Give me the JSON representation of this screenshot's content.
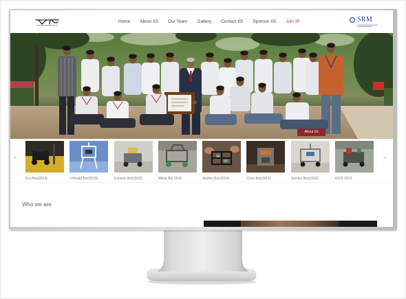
{
  "nav": {
    "items": [
      {
        "label": "Home"
      },
      {
        "label": "About IIS"
      },
      {
        "label": "Our Team"
      },
      {
        "label": "Gallery"
      },
      {
        "label": "Contact IIS"
      },
      {
        "label": "Sponsor IIS"
      },
      {
        "label": "Join IR",
        "highlighted": true
      }
    ]
  },
  "site_logo": {
    "icon": "team-logo"
  },
  "partner_logo": {
    "text": "SRM",
    "icon": "university-emblem-icon"
  },
  "hero": {
    "cta_label": "About Us"
  },
  "carousel": {
    "prev": {
      "icon": "chevron-left-icon",
      "glyph": "‹"
    },
    "next": {
      "icon": "chevron-right-icon",
      "glyph": "›"
    },
    "items": [
      {
        "caption": "Eco Bot(2014)"
      },
      {
        "caption": "I-Herald Bot(2018)"
      },
      {
        "caption": "Convoic Bot(2015)"
      },
      {
        "caption": "Militia Bot 2016"
      },
      {
        "caption": "Mother Bot(2014)"
      },
      {
        "caption": "Chex Bot(2014)"
      },
      {
        "caption": "Service Bot(2016)"
      },
      {
        "caption": "ROIT-2013"
      }
    ]
  },
  "about": {
    "heading": "Who we are"
  },
  "colors": {
    "accent": "#cc2f2f",
    "cta_background": "#8f2430",
    "partner_brand": "#1e3f8c"
  }
}
